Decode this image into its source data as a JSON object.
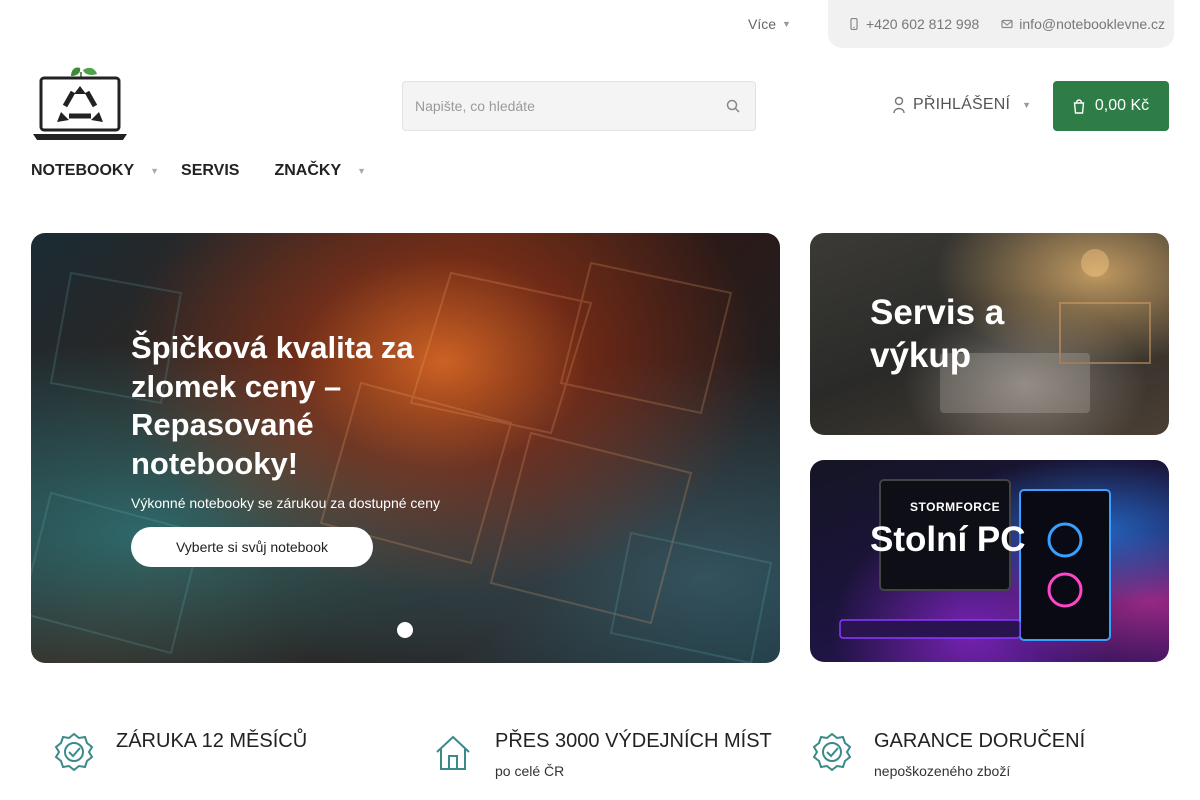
{
  "topbar": {
    "more_label": "Více",
    "phone": "+420 602 812 998",
    "email": "info@notebooklevne.cz"
  },
  "search": {
    "placeholder": "Napište, co hledáte"
  },
  "account": {
    "login_label": "PŘIHLÁŠENÍ"
  },
  "cart": {
    "total": "0,00 Kč"
  },
  "nav": {
    "items": [
      {
        "label": "NOTEBOOKY"
      },
      {
        "label": "SERVIS"
      },
      {
        "label": "ZNAČKY"
      }
    ]
  },
  "hero": {
    "title": "Špičková kvalita za zlomek ceny – Repasované notebooky!",
    "subtitle": "Výkonné notebooky se zárukou za dostupné ceny",
    "cta": "Vyberte si svůj notebook"
  },
  "cards": [
    {
      "title": "Servis a výkup"
    },
    {
      "title": "Stolní PC",
      "brand_text": "STORMFORCE"
    }
  ],
  "features": [
    {
      "title": "ZÁRUKA 12 MĚSÍCŮ",
      "subtitle": ""
    },
    {
      "title": "PŘES 3000 VÝDEJNÍCH MÍST",
      "subtitle": "po celé ČR"
    },
    {
      "title": "GARANCE DORUČENÍ",
      "subtitle": "nepoškozeného zboží"
    }
  ],
  "colors": {
    "accent": "#2e7d46",
    "feature_icon": "#3a8a8a"
  },
  "icons": {
    "phone": "phone-icon",
    "email": "envelope-icon",
    "search": "search-icon",
    "login": "user-icon",
    "cart": "cart-icon",
    "warranty": "badge-check-icon",
    "pickup": "home-icon",
    "delivery": "badge-check-icon"
  }
}
